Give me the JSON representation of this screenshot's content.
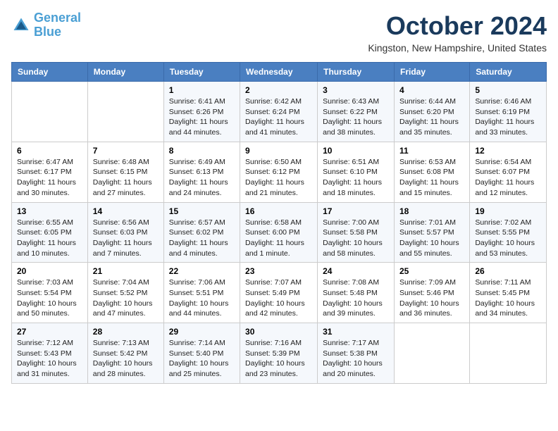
{
  "header": {
    "logo_line1": "General",
    "logo_line2": "Blue",
    "month_title": "October 2024",
    "location": "Kingston, New Hampshire, United States"
  },
  "days_of_week": [
    "Sunday",
    "Monday",
    "Tuesday",
    "Wednesday",
    "Thursday",
    "Friday",
    "Saturday"
  ],
  "weeks": [
    [
      {
        "day": "",
        "sunrise": "",
        "sunset": "",
        "daylight": ""
      },
      {
        "day": "",
        "sunrise": "",
        "sunset": "",
        "daylight": ""
      },
      {
        "day": "1",
        "sunrise": "Sunrise: 6:41 AM",
        "sunset": "Sunset: 6:26 PM",
        "daylight": "Daylight: 11 hours and 44 minutes."
      },
      {
        "day": "2",
        "sunrise": "Sunrise: 6:42 AM",
        "sunset": "Sunset: 6:24 PM",
        "daylight": "Daylight: 11 hours and 41 minutes."
      },
      {
        "day": "3",
        "sunrise": "Sunrise: 6:43 AM",
        "sunset": "Sunset: 6:22 PM",
        "daylight": "Daylight: 11 hours and 38 minutes."
      },
      {
        "day": "4",
        "sunrise": "Sunrise: 6:44 AM",
        "sunset": "Sunset: 6:20 PM",
        "daylight": "Daylight: 11 hours and 35 minutes."
      },
      {
        "day": "5",
        "sunrise": "Sunrise: 6:46 AM",
        "sunset": "Sunset: 6:19 PM",
        "daylight": "Daylight: 11 hours and 33 minutes."
      }
    ],
    [
      {
        "day": "6",
        "sunrise": "Sunrise: 6:47 AM",
        "sunset": "Sunset: 6:17 PM",
        "daylight": "Daylight: 11 hours and 30 minutes."
      },
      {
        "day": "7",
        "sunrise": "Sunrise: 6:48 AM",
        "sunset": "Sunset: 6:15 PM",
        "daylight": "Daylight: 11 hours and 27 minutes."
      },
      {
        "day": "8",
        "sunrise": "Sunrise: 6:49 AM",
        "sunset": "Sunset: 6:13 PM",
        "daylight": "Daylight: 11 hours and 24 minutes."
      },
      {
        "day": "9",
        "sunrise": "Sunrise: 6:50 AM",
        "sunset": "Sunset: 6:12 PM",
        "daylight": "Daylight: 11 hours and 21 minutes."
      },
      {
        "day": "10",
        "sunrise": "Sunrise: 6:51 AM",
        "sunset": "Sunset: 6:10 PM",
        "daylight": "Daylight: 11 hours and 18 minutes."
      },
      {
        "day": "11",
        "sunrise": "Sunrise: 6:53 AM",
        "sunset": "Sunset: 6:08 PM",
        "daylight": "Daylight: 11 hours and 15 minutes."
      },
      {
        "day": "12",
        "sunrise": "Sunrise: 6:54 AM",
        "sunset": "Sunset: 6:07 PM",
        "daylight": "Daylight: 11 hours and 12 minutes."
      }
    ],
    [
      {
        "day": "13",
        "sunrise": "Sunrise: 6:55 AM",
        "sunset": "Sunset: 6:05 PM",
        "daylight": "Daylight: 11 hours and 10 minutes."
      },
      {
        "day": "14",
        "sunrise": "Sunrise: 6:56 AM",
        "sunset": "Sunset: 6:03 PM",
        "daylight": "Daylight: 11 hours and 7 minutes."
      },
      {
        "day": "15",
        "sunrise": "Sunrise: 6:57 AM",
        "sunset": "Sunset: 6:02 PM",
        "daylight": "Daylight: 11 hours and 4 minutes."
      },
      {
        "day": "16",
        "sunrise": "Sunrise: 6:58 AM",
        "sunset": "Sunset: 6:00 PM",
        "daylight": "Daylight: 11 hours and 1 minute."
      },
      {
        "day": "17",
        "sunrise": "Sunrise: 7:00 AM",
        "sunset": "Sunset: 5:58 PM",
        "daylight": "Daylight: 10 hours and 58 minutes."
      },
      {
        "day": "18",
        "sunrise": "Sunrise: 7:01 AM",
        "sunset": "Sunset: 5:57 PM",
        "daylight": "Daylight: 10 hours and 55 minutes."
      },
      {
        "day": "19",
        "sunrise": "Sunrise: 7:02 AM",
        "sunset": "Sunset: 5:55 PM",
        "daylight": "Daylight: 10 hours and 53 minutes."
      }
    ],
    [
      {
        "day": "20",
        "sunrise": "Sunrise: 7:03 AM",
        "sunset": "Sunset: 5:54 PM",
        "daylight": "Daylight: 10 hours and 50 minutes."
      },
      {
        "day": "21",
        "sunrise": "Sunrise: 7:04 AM",
        "sunset": "Sunset: 5:52 PM",
        "daylight": "Daylight: 10 hours and 47 minutes."
      },
      {
        "day": "22",
        "sunrise": "Sunrise: 7:06 AM",
        "sunset": "Sunset: 5:51 PM",
        "daylight": "Daylight: 10 hours and 44 minutes."
      },
      {
        "day": "23",
        "sunrise": "Sunrise: 7:07 AM",
        "sunset": "Sunset: 5:49 PM",
        "daylight": "Daylight: 10 hours and 42 minutes."
      },
      {
        "day": "24",
        "sunrise": "Sunrise: 7:08 AM",
        "sunset": "Sunset: 5:48 PM",
        "daylight": "Daylight: 10 hours and 39 minutes."
      },
      {
        "day": "25",
        "sunrise": "Sunrise: 7:09 AM",
        "sunset": "Sunset: 5:46 PM",
        "daylight": "Daylight: 10 hours and 36 minutes."
      },
      {
        "day": "26",
        "sunrise": "Sunrise: 7:11 AM",
        "sunset": "Sunset: 5:45 PM",
        "daylight": "Daylight: 10 hours and 34 minutes."
      }
    ],
    [
      {
        "day": "27",
        "sunrise": "Sunrise: 7:12 AM",
        "sunset": "Sunset: 5:43 PM",
        "daylight": "Daylight: 10 hours and 31 minutes."
      },
      {
        "day": "28",
        "sunrise": "Sunrise: 7:13 AM",
        "sunset": "Sunset: 5:42 PM",
        "daylight": "Daylight: 10 hours and 28 minutes."
      },
      {
        "day": "29",
        "sunrise": "Sunrise: 7:14 AM",
        "sunset": "Sunset: 5:40 PM",
        "daylight": "Daylight: 10 hours and 25 minutes."
      },
      {
        "day": "30",
        "sunrise": "Sunrise: 7:16 AM",
        "sunset": "Sunset: 5:39 PM",
        "daylight": "Daylight: 10 hours and 23 minutes."
      },
      {
        "day": "31",
        "sunrise": "Sunrise: 7:17 AM",
        "sunset": "Sunset: 5:38 PM",
        "daylight": "Daylight: 10 hours and 20 minutes."
      },
      {
        "day": "",
        "sunrise": "",
        "sunset": "",
        "daylight": ""
      },
      {
        "day": "",
        "sunrise": "",
        "sunset": "",
        "daylight": ""
      }
    ]
  ]
}
